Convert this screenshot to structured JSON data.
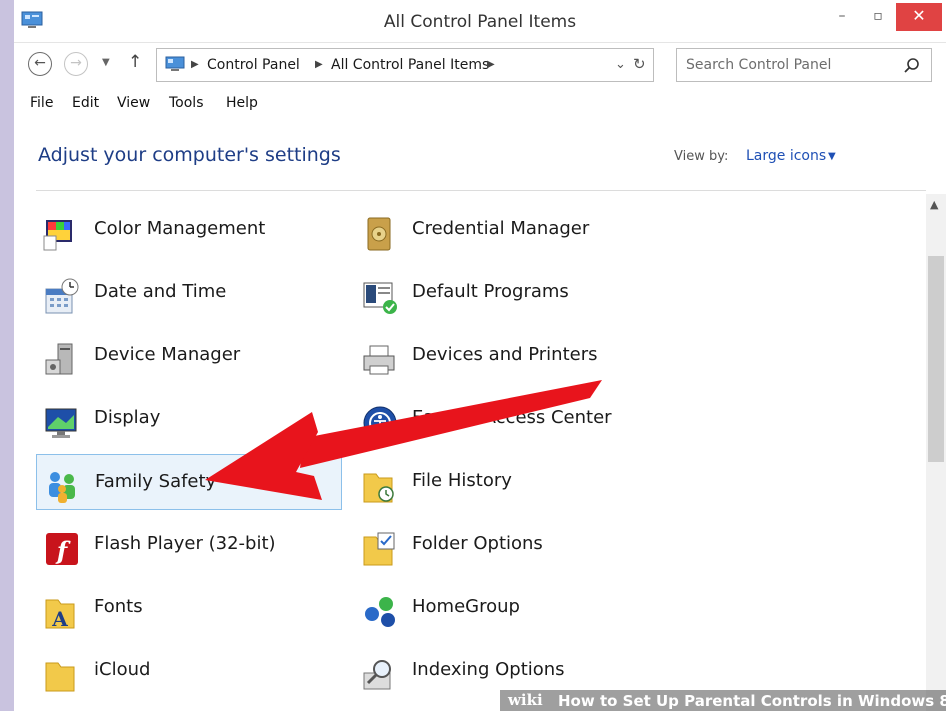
{
  "window": {
    "title": "All Control Panel Items",
    "minimize_label": "–",
    "maximize_label": "▫",
    "close_label": "✕"
  },
  "addressbar": {
    "crumbs": [
      "Control Panel",
      "All Control Panel Items"
    ],
    "search_placeholder": "Search Control Panel"
  },
  "menu": [
    "File",
    "Edit",
    "View",
    "Tools",
    "Help"
  ],
  "header": {
    "title": "Adjust your computer's settings",
    "view_by_label": "View by:",
    "view_by_value": "Large icons"
  },
  "items": {
    "left": [
      {
        "label": "Color Management",
        "icon": "color-management-icon"
      },
      {
        "label": "Date and Time",
        "icon": "date-time-icon"
      },
      {
        "label": "Device Manager",
        "icon": "device-manager-icon"
      },
      {
        "label": "Display",
        "icon": "display-icon"
      },
      {
        "label": "Family Safety",
        "icon": "family-safety-icon",
        "selected": true
      },
      {
        "label": "Flash Player (32-bit)",
        "icon": "flash-player-icon"
      },
      {
        "label": "Fonts",
        "icon": "fonts-icon"
      },
      {
        "label": "iCloud",
        "icon": "icloud-icon"
      }
    ],
    "right": [
      {
        "label": "Credential Manager",
        "icon": "credential-manager-icon"
      },
      {
        "label": "Default Programs",
        "icon": "default-programs-icon"
      },
      {
        "label": "Devices and Printers",
        "icon": "devices-printers-icon"
      },
      {
        "label": "Ease of Access Center",
        "icon": "ease-of-access-icon"
      },
      {
        "label": "File History",
        "icon": "file-history-icon"
      },
      {
        "label": "Folder Options",
        "icon": "folder-options-icon"
      },
      {
        "label": "HomeGroup",
        "icon": "homegroup-icon"
      },
      {
        "label": "Indexing Options",
        "icon": "indexing-options-icon"
      }
    ]
  },
  "watermark": {
    "brand": "wiki",
    "title": "How to Set Up Parental Controls in Windows 8"
  },
  "colors": {
    "arrow": "#e8141c",
    "heading": "#1e3d86",
    "link": "#1f50b5",
    "selection_bg": "#eaf3fb",
    "close_button": "#e04343"
  }
}
